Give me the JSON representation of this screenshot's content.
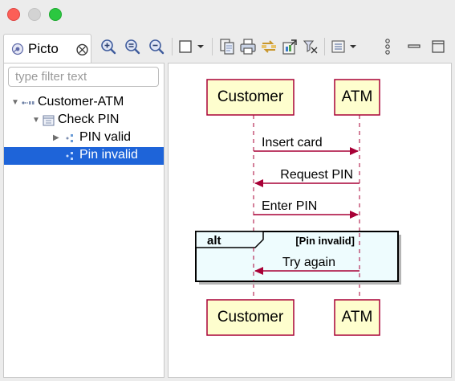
{
  "window": {
    "title": ""
  },
  "view": {
    "tab_label": "Picto",
    "tab_icon": "picto-icon",
    "close_icon": "close-icon"
  },
  "toolbar": {
    "buttons": [
      {
        "icon": "zoom-in-icon"
      },
      {
        "icon": "zoom-reset-icon"
      },
      {
        "icon": "zoom-out-icon"
      },
      {
        "icon": "layout-dropdown-icon"
      },
      {
        "icon": "copy-icon"
      },
      {
        "icon": "print-icon"
      },
      {
        "icon": "sync-icon"
      },
      {
        "icon": "export-icon"
      },
      {
        "icon": "filter-icon"
      },
      {
        "icon": "layers-dropdown-icon"
      },
      {
        "icon": "view-menu-icon"
      },
      {
        "icon": "minimize-icon"
      },
      {
        "icon": "maximize-icon"
      }
    ]
  },
  "filter": {
    "placeholder": "type filter text",
    "value": ""
  },
  "tree": {
    "items": [
      {
        "label": "Customer-ATM",
        "icon": "sequence-diagram-icon",
        "expanded": true,
        "level": 0
      },
      {
        "label": "Check PIN",
        "icon": "interaction-icon",
        "expanded": true,
        "level": 1
      },
      {
        "label": "PIN valid",
        "icon": "fragment-icon",
        "expanded": false,
        "level": 2
      },
      {
        "label": "Pin invalid",
        "icon": "fragment-icon",
        "selected": true,
        "level": 2
      }
    ]
  },
  "diagram": {
    "participants": [
      {
        "name": "Customer"
      },
      {
        "name": "ATM"
      }
    ],
    "messages": [
      {
        "label": "Insert card",
        "from": "Customer",
        "to": "ATM"
      },
      {
        "label": "Request PIN",
        "from": "ATM",
        "to": "Customer"
      },
      {
        "label": "Enter PIN",
        "from": "Customer",
        "to": "ATM"
      },
      {
        "label": "Try again",
        "from": "ATM",
        "to": "Customer"
      }
    ],
    "fragment": {
      "operator": "alt",
      "guard": "[Pin invalid]"
    },
    "colors": {
      "participant_fill": "#fefece",
      "participant_border": "#a80036",
      "arrow": "#a80036",
      "fragment_fill": "#eefcfe",
      "selection": "#1e64d9"
    }
  }
}
